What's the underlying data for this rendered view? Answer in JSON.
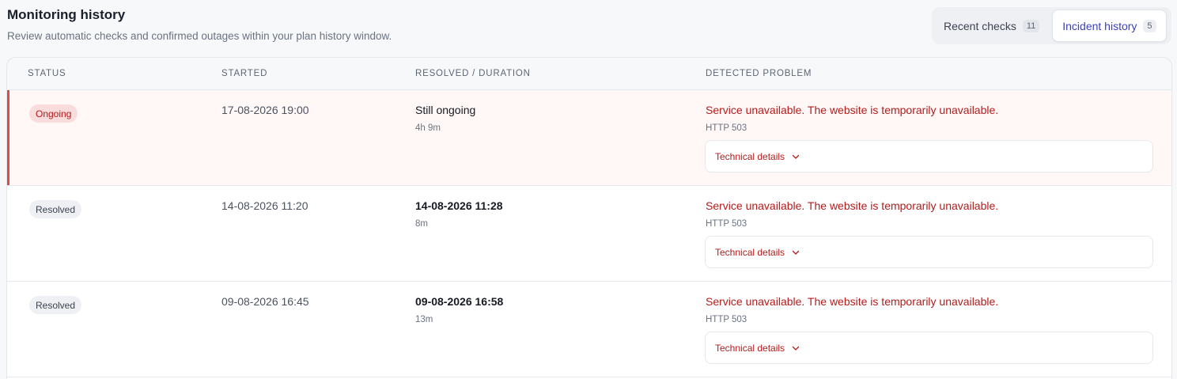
{
  "header": {
    "title": "Monitoring history",
    "subtitle": "Review automatic checks and confirmed outages within your plan history window."
  },
  "tabs": [
    {
      "label": "Recent checks",
      "count": "11",
      "active": false
    },
    {
      "label": "Incident history",
      "count": "5",
      "active": true
    }
  ],
  "table": {
    "columns": [
      "STATUS",
      "STARTED",
      "RESOLVED / DURATION",
      "DETECTED PROBLEM"
    ],
    "rows": [
      {
        "status": "Ongoing",
        "started": "17-08-2026 19:00",
        "resolved": "Still ongoing",
        "duration": "4h 9m",
        "problem": "Service unavailable. The website is temporarily unavailable.",
        "http": "HTTP 503",
        "details_label": "Technical details"
      },
      {
        "status": "Resolved",
        "started": "14-08-2026 11:20",
        "resolved": "14-08-2026 11:28",
        "duration": "8m",
        "problem": "Service unavailable. The website is temporarily unavailable.",
        "http": "HTTP 503",
        "details_label": "Technical details"
      },
      {
        "status": "Resolved",
        "started": "09-08-2026 16:45",
        "resolved": "09-08-2026 16:58",
        "duration": "13m",
        "problem": "Service unavailable. The website is temporarily unavailable.",
        "http": "HTTP 503",
        "details_label": "Technical details"
      }
    ]
  },
  "colors": {
    "accent": "#3b3fbf",
    "error": "#b41c1c",
    "ongoing_bar": "#e34848"
  },
  "icons": {
    "details_toggle": "chevron-down-icon"
  }
}
